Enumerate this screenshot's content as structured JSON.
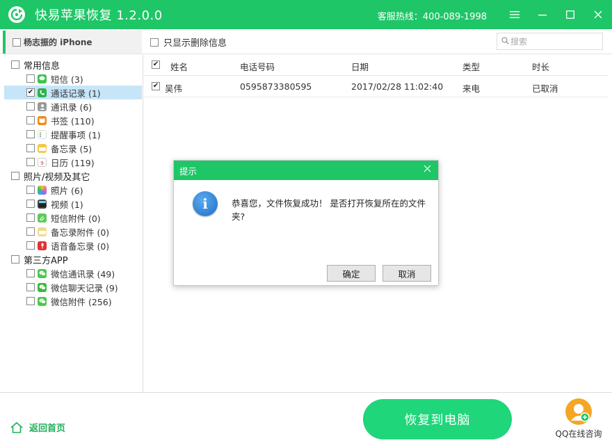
{
  "window": {
    "title": "快易苹果恢复  1.2.0.0",
    "hotline": "客服热线：400-089-1998",
    "menu_icon": "menu-icon",
    "minimize_icon": "minimize-icon",
    "maximize_icon": "maximize-icon",
    "close_icon": "close-icon"
  },
  "toolbar": {
    "device_label": "杨志振的 iPhone",
    "only_deleted_label": "只显示删除信息",
    "search_placeholder": "搜索"
  },
  "sidebar": {
    "categories": [
      {
        "label": "常用信息",
        "items": [
          {
            "label": "短信 (3)",
            "icon": "sms-icon",
            "color": "#3cc54a"
          },
          {
            "label": "通话记录 (1)",
            "icon": "phone-icon",
            "color": "#2eb14a",
            "checked": true,
            "selected": true
          },
          {
            "label": "通讯录 (6)",
            "icon": "contacts-icon",
            "color": "#9a9a9a"
          },
          {
            "label": "书签 (110)",
            "icon": "bookmark-icon",
            "color": "#f08a1c"
          },
          {
            "label": "提醒事项 (1)",
            "icon": "reminder-icon",
            "color": "#cccccc"
          },
          {
            "label": "备忘录 (5)",
            "icon": "notes-icon",
            "color": "#f2c94c"
          },
          {
            "label": "日历 (119)",
            "icon": "calendar-icon",
            "color": "#e0e0e0"
          }
        ]
      },
      {
        "label": "照片/视频及其它",
        "items": [
          {
            "label": "照片 (6)",
            "icon": "photos-icon",
            "color": "#e86aa5"
          },
          {
            "label": "视频 (1)",
            "icon": "video-icon",
            "color": "#444444"
          },
          {
            "label": "短信附件 (0)",
            "icon": "sms-attachment-icon",
            "color": "#5ccc5a"
          },
          {
            "label": "备忘录附件 (0)",
            "icon": "notes-attachment-icon",
            "color": "#f5d889"
          },
          {
            "label": "语音备忘录 (0)",
            "icon": "voice-memo-icon",
            "color": "#e03333"
          }
        ]
      },
      {
        "label": "第三方APP",
        "items": [
          {
            "label": "微信通讯录 (49)",
            "icon": "wechat-contacts-icon",
            "color": "#4cc74c"
          },
          {
            "label": "微信聊天记录 (9)",
            "icon": "wechat-chat-icon",
            "color": "#3db83d"
          },
          {
            "label": "微信附件 (256)",
            "icon": "wechat-attachment-icon",
            "color": "#4cc74c"
          }
        ]
      }
    ]
  },
  "table": {
    "headers": [
      "姓名",
      "电话号码",
      "日期",
      "类型",
      "时长"
    ],
    "rows": [
      {
        "checked": true,
        "cells": [
          "吴伟",
          "0595873380595",
          "2017/02/28 11:02:40",
          "来电",
          "已取消"
        ]
      }
    ]
  },
  "footer": {
    "back_label": "返回首页",
    "recover_label": "恢复到电脑",
    "qq_label": "QQ在线咨询"
  },
  "dialog": {
    "title": "提示",
    "message": "恭喜您，文件恢复成功！ 是否打开恢复所在的文件夹?",
    "ok_label": "确定",
    "cancel_label": "取消"
  },
  "colors": {
    "brand": "#1fc667",
    "recover_button": "#1fd67a",
    "selected_row": "#c7e5f8",
    "qq_orange": "#f5a623"
  }
}
